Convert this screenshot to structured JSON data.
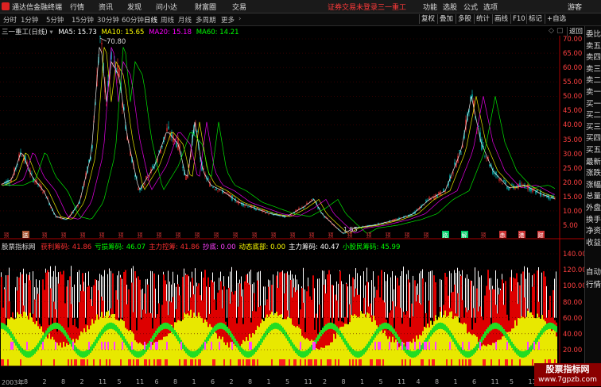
{
  "topbar": {
    "app_title": "通达信金融终端",
    "menus": [
      "行情",
      "资讯",
      "发现",
      "问小达",
      "财富圈",
      "交易"
    ],
    "login_status": "证券交易未登录",
    "stock_name": "三一重工",
    "right_menus": [
      "功能",
      "选股",
      "公式",
      "选项",
      "游客"
    ]
  },
  "tabs": {
    "periods": [
      "分时",
      "1分钟",
      "5分钟",
      "15分钟",
      "30分钟",
      "60分钟",
      "日线",
      "周线",
      "月线",
      "多周期",
      "更多"
    ],
    "active": "日线",
    "right_tools": [
      "复权",
      "叠加",
      "多股",
      "统计",
      "画线",
      "F10",
      "标记",
      "+自选",
      "返回"
    ]
  },
  "kline": {
    "title": "三一重工(日线)",
    "ma": [
      {
        "label": "MA5",
        "value": "15.73",
        "color": "#ffffff"
      },
      {
        "label": "MA10",
        "value": "15.65",
        "color": "#ffff00"
      },
      {
        "label": "MA20",
        "value": "15.18",
        "color": "#ff00ff"
      },
      {
        "label": "MA60",
        "value": "14.21",
        "color": "#00ff00"
      }
    ],
    "high_label": "70.80",
    "low_label": "1.55",
    "axis": [
      "70.00",
      "65.00",
      "60.00",
      "55.00",
      "50.00",
      "45.00",
      "40.00",
      "35.00",
      "30.00",
      "25.00",
      "20.00",
      "15.00",
      "10.00",
      "5.00"
    ]
  },
  "indicator": {
    "name": "股票指标网",
    "items": [
      {
        "label": "获利筹码:",
        "value": "41.86",
        "color": "#ff3030"
      },
      {
        "label": "亏损筹码:",
        "value": "46.07",
        "color": "#00ff00"
      },
      {
        "label": "主力控筹:",
        "value": "41.86",
        "color": "#ff3030"
      },
      {
        "label": "抄底:",
        "value": "0.00",
        "color": "#ff40ff"
      },
      {
        "label": "动态底部:",
        "value": "0.00",
        "color": "#ffff00"
      },
      {
        "label": "主力筹码:",
        "value": "40.47",
        "color": "#ffffff"
      },
      {
        "label": "小股民筹码:",
        "value": "45.99",
        "color": "#00ff00"
      }
    ],
    "axis": [
      "140.00",
      "120.00",
      "100.00",
      "80.00",
      "60.00",
      "40.00",
      "20.00"
    ]
  },
  "markers": [
    "预",
    "送",
    "预",
    "预",
    "预",
    "预",
    "预",
    "预",
    "预",
    "预",
    "预",
    "预",
    "预",
    "预",
    "预",
    "预",
    "预",
    "预",
    "预",
    "预",
    "预",
    "预",
    "预",
    "路",
    "解",
    "预",
    "赤",
    "港",
    "财"
  ],
  "x_labels": [
    "2003年",
    "8",
    "2",
    "8",
    "2",
    "11",
    "5",
    "11",
    "6",
    "8",
    "1",
    "6",
    "2",
    "8",
    "1",
    "5",
    "11",
    "2",
    "8",
    "1",
    "5",
    "11",
    "4",
    "8",
    "1",
    "6",
    "11",
    "5",
    "11"
  ],
  "side_panel": [
    "委比",
    "卖五",
    "卖四",
    "卖三",
    "卖二",
    "卖一",
    "买一",
    "买二",
    "买三",
    "买四",
    "买五",
    "最新",
    "涨跌",
    "涨幅",
    "总量",
    "外盘",
    "换手",
    "净资",
    "收益",
    "自动",
    "行情"
  ],
  "watermark": {
    "title": "股票指标网",
    "url": "www.7gpzb.com"
  }
}
